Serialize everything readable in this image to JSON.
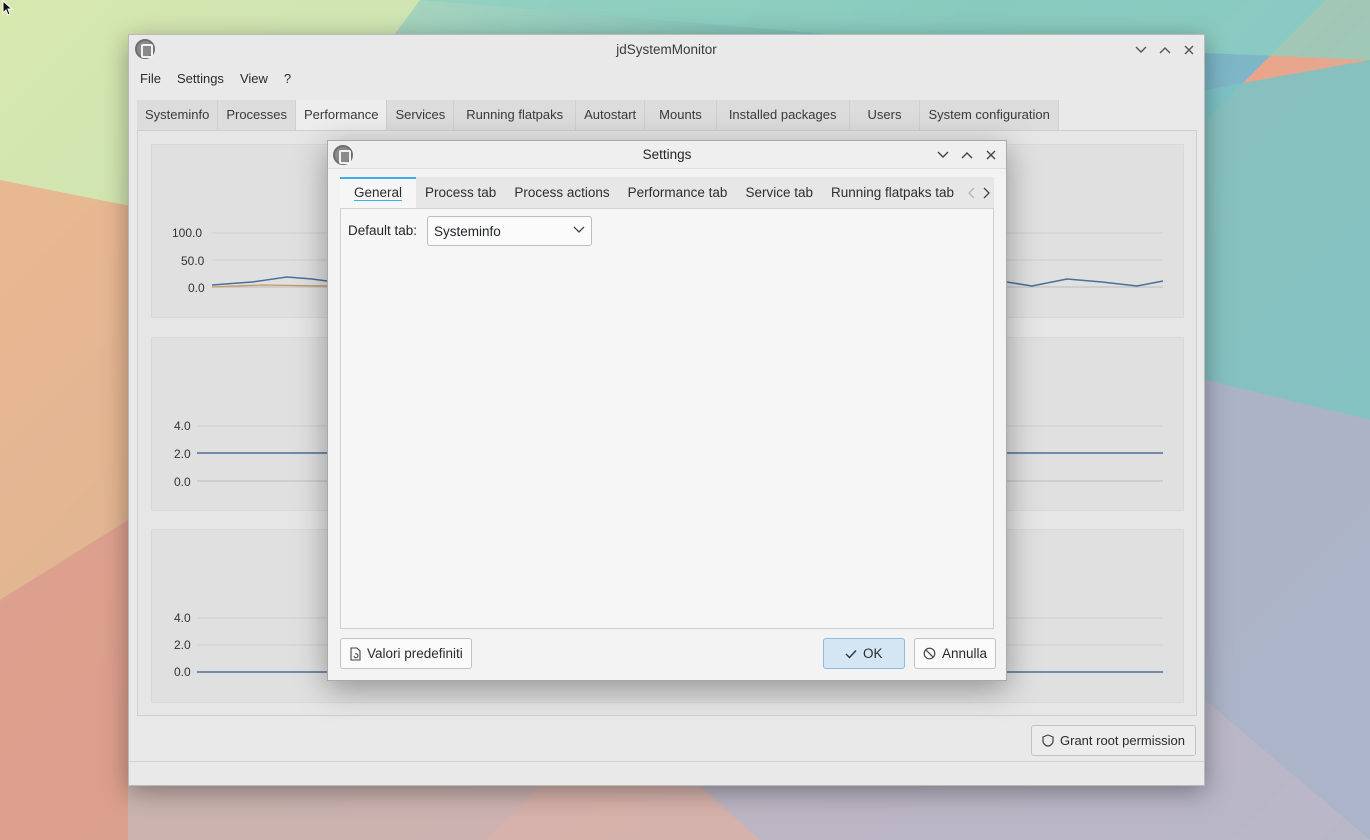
{
  "main_window": {
    "title": "jdSystemMonitor",
    "menu": [
      "File",
      "Settings",
      "View",
      "?"
    ],
    "tabs": [
      "Systeminfo",
      "Processes",
      "Performance",
      "Services",
      "Running flatpaks",
      "Autostart",
      "Mounts",
      "Installed packages",
      "Users",
      "System configuration"
    ],
    "active_tab": "Performance",
    "grant_button": "Grant root permission"
  },
  "charts": [
    {
      "ticks": [
        "100.0",
        "50.0",
        "0.0"
      ]
    },
    {
      "ticks": [
        "4.0",
        "2.0",
        "0.0"
      ]
    },
    {
      "ticks": [
        "4.0",
        "2.0",
        "0.0"
      ]
    }
  ],
  "dialog": {
    "title": "Settings",
    "tabs": [
      "General",
      "Process tab",
      "Process actions",
      "Performance tab",
      "Service tab",
      "Running flatpaks tab"
    ],
    "active_tab": "General",
    "field_label": "Default tab:",
    "combo_value": "Systeminfo",
    "defaults_button": "Valori predefiniti",
    "ok_button": "OK",
    "cancel_button": "Annulla"
  },
  "colors": {
    "accent": "#3daee9",
    "ok_bg": "#d4e5f3"
  }
}
